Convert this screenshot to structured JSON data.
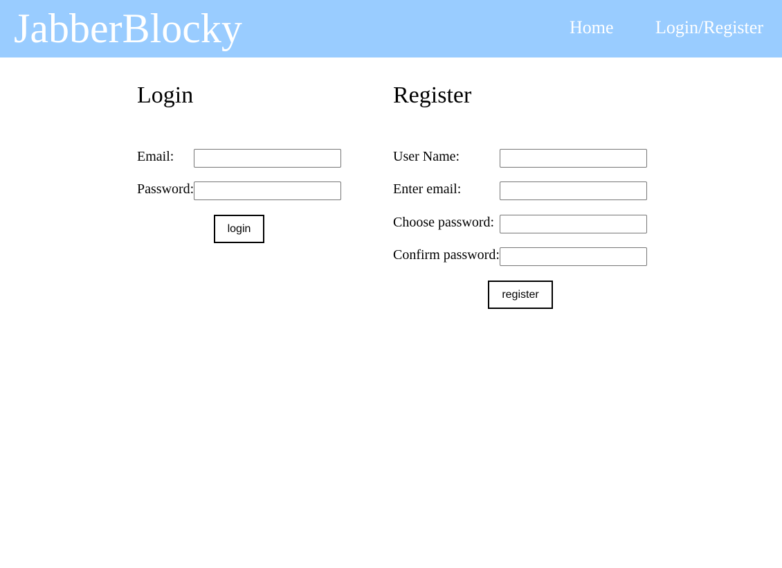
{
  "header": {
    "brand": "JabberBlocky",
    "nav": {
      "home": "Home",
      "login_register": "Login/Register"
    },
    "background": "#99ccff"
  },
  "login": {
    "title": "Login",
    "email_label": "Email:",
    "email_value": "",
    "password_label": "Password:",
    "password_value": "",
    "button_label": "login"
  },
  "register": {
    "title": "Register",
    "username_label": "User Name:",
    "username_value": "",
    "email_label": "Enter email:",
    "email_value": "",
    "password_label": "Choose password:",
    "password_value": "",
    "confirm_label": "Confirm password:",
    "confirm_value": "",
    "button_label": "register"
  }
}
